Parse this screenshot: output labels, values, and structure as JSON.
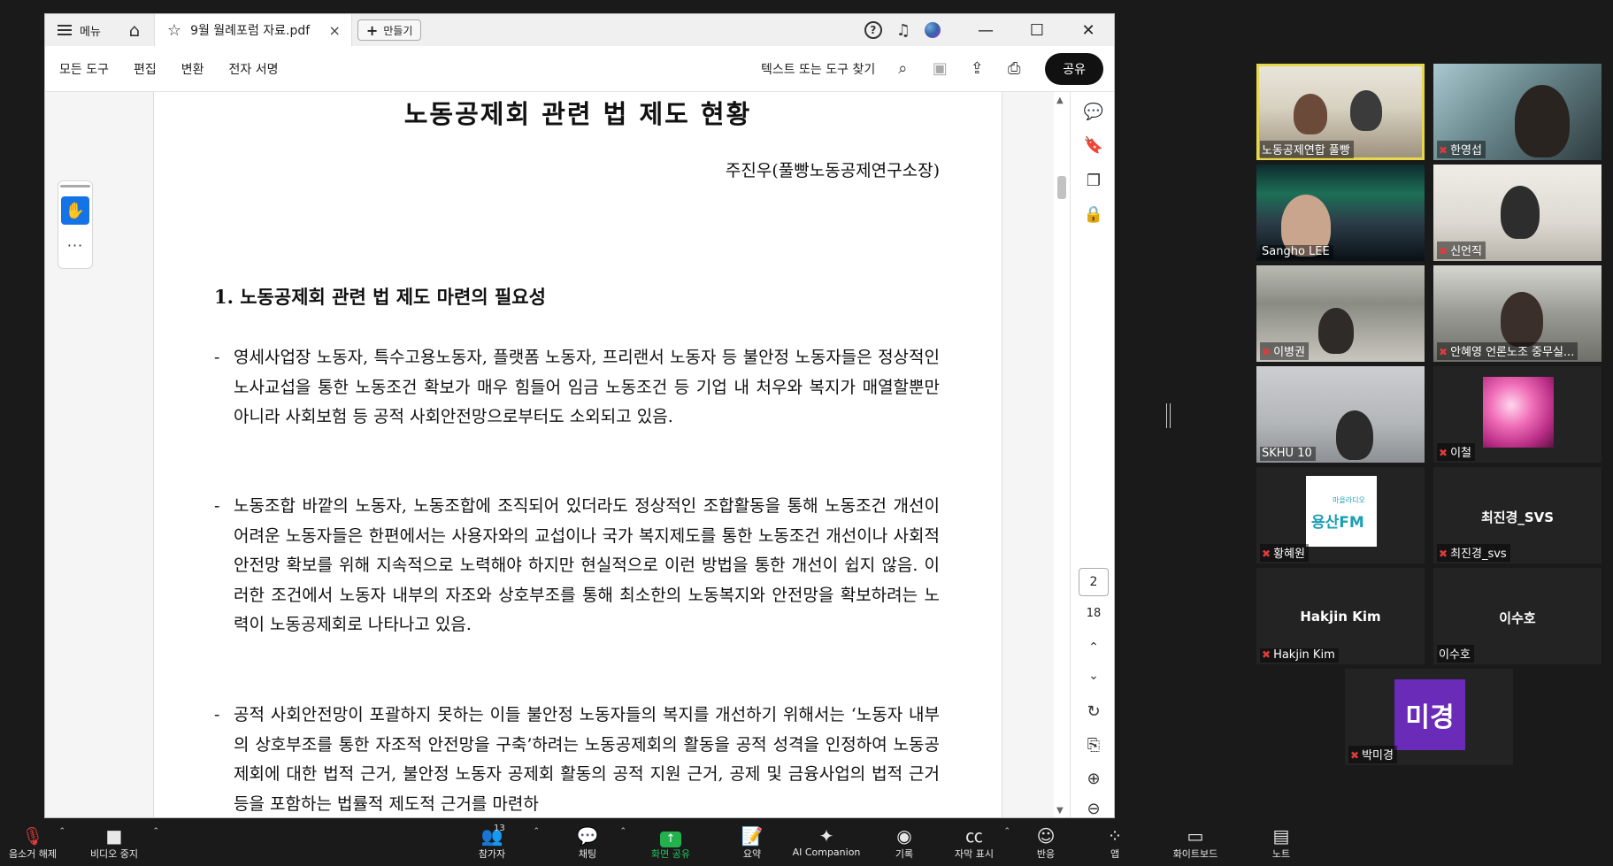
{
  "pdf_window": {
    "titlebar": {
      "menu_label": "메뉴",
      "tab_name": "9월 월례포럼 자료.pdf",
      "tab_close": "×",
      "new_label": "만들기",
      "help_icon": "?",
      "minimize": "—",
      "maximize": "☐",
      "close": "✕"
    },
    "toolbar": {
      "all_tools": "모든 도구",
      "edit": "편집",
      "convert": "변환",
      "esign": "전자 서명",
      "find_placeholder": "텍스트 또는 도구 찾기",
      "share": "공유"
    },
    "left_rail": {
      "more": "···"
    },
    "document": {
      "title": "노동공제회 관련 법 제도 현황",
      "author": "주진우(풀빵노동공제연구소장)",
      "section_heading": "1. 노동공제회 관련 법 제도 마련의 필요성",
      "paragraphs": [
        "영세사업장 노동자, 특수고용노동자, 플랫폼 노동자, 프리랜서 노동자 등 불안정 노동자들은 정상적인 노사교섭을 통한 노동조건 확보가 매우 힘들어 임금 노동조건 등 기업 내 처우와 복지가 매열할뿐만 아니라 사회보험 등 공적 사회안전망으로부터도 소외되고 있음.",
        "노동조합 바깥의 노동자, 노동조합에 조직되어 있더라도 정상적인 조합활동을 통해 노동조건 개선이 어려운 노동자들은 한편에서는 사용자와의 교섭이나 국가 복지제도를 통한 노동조건 개선이나 사회적 안전망 확보를 위해 지속적으로 노력해야 하지만 현실적으로 이런 방법을 통한 개선이 쉽지 않음. 이러한 조건에서 노동자 내부의 자조와 상호부조를 통해 최소한의 노동복지와 안전망을 확보하려는 노력이 노동공제회로 나타나고 있음.",
        "공적 사회안전망이 포괄하지 못하는 이들 불안정 노동자들의 복지를 개선하기 위해서는 ‘노동자 내부의 상호부조를 통한 자조적 안전망을 구축’하려는 노동공제회의 활동을 공적 성격을 인정하여 노동공제회에 대한 법적 근거, 불안정 노동자 공제회 활동의 공적 지원 근거, 공제 및 금융사업의 법적 근거 등을 포함하는 법률적 제도적 근거를 마련하"
      ],
      "dash": "-"
    },
    "right_rail": {
      "current_page": "2",
      "total_pages": "18"
    }
  },
  "gallery": {
    "tiles": [
      {
        "label": "노동공제연합 풀빵",
        "muted": false,
        "active": true
      },
      {
        "label": "한영섭",
        "muted": true
      },
      {
        "label": "Sangho LEE",
        "muted": false
      },
      {
        "label": "신언직",
        "muted": true
      },
      {
        "label": "이병권",
        "muted": true
      },
      {
        "label": "안혜영 언론노조 중무실...",
        "muted": true
      },
      {
        "label": "SKHU 10",
        "muted": false
      },
      {
        "label": "이철",
        "muted": true
      },
      {
        "label": "황혜원",
        "muted": true,
        "logo_text": "용산FM",
        "logo_small": "마을라디오"
      },
      {
        "label": "최진경_svs",
        "muted": true,
        "center": "최진경_SVS"
      },
      {
        "label": "Hakjin Kim",
        "muted": true,
        "center": "Hakjin Kim"
      },
      {
        "label": "이수호",
        "muted": false,
        "center": "이수호"
      },
      {
        "label": "박미경",
        "muted": true,
        "avatar_text": "미경"
      }
    ]
  },
  "zoom_bar": {
    "unmute": "음소거 해제",
    "stop_video": "비디오 중지",
    "participants": "참가자",
    "participants_count": "13",
    "chat": "채팅",
    "share_screen": "화면 공유",
    "summary": "요약",
    "ai_companion": "AI Companion",
    "record": "기록",
    "captions": "자막 표시",
    "reactions": "반응",
    "apps": "앱",
    "whiteboard": "화이트보드",
    "notes": "노트",
    "colors": {
      "share_green": "#22c55e",
      "mute_red": "#e03b3b",
      "active_tile": "#e5d84d"
    }
  }
}
